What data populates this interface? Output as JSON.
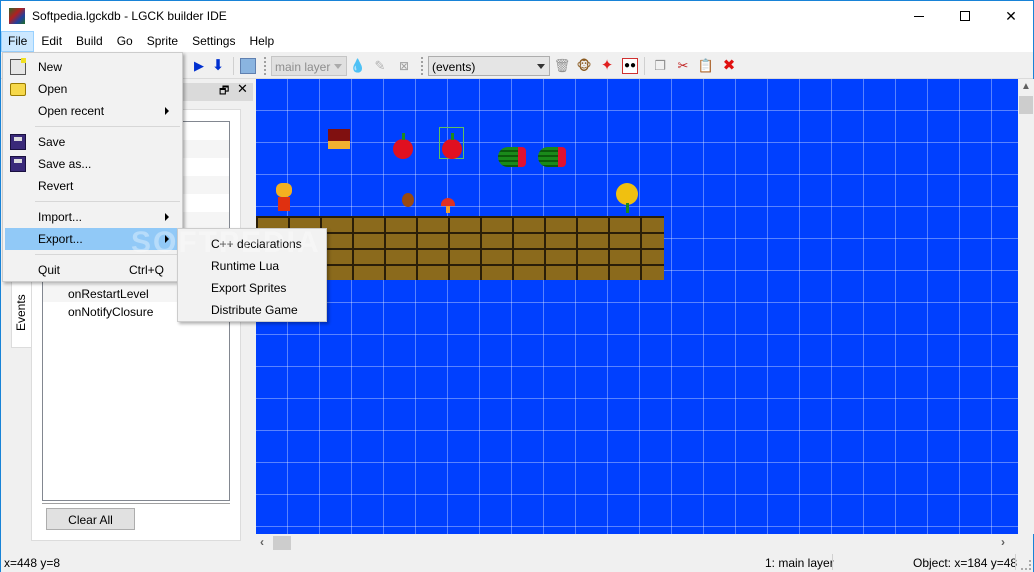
{
  "window": {
    "title": "Softpedia.lgckdb - LGCK builder IDE",
    "controls": [
      "minimize",
      "maximize",
      "close"
    ]
  },
  "menubar": {
    "items": [
      {
        "label": "File",
        "active": true
      },
      {
        "label": "Edit"
      },
      {
        "label": "Build"
      },
      {
        "label": "Go"
      },
      {
        "label": "Sprite"
      },
      {
        "label": "Settings"
      },
      {
        "label": "Help"
      }
    ]
  },
  "toolbar": {
    "layer_combo": {
      "value": "main layer",
      "enabled": false
    },
    "events_combo": {
      "value": "(events)"
    },
    "icons": [
      "play-icon",
      "arrow-down-icon",
      "sprite-editor-icon",
      "water-drop-icon",
      "pin-icon",
      "delete-box-icon",
      "trash-icon",
      "monkey-icon",
      "star-icon",
      "footprints-icon",
      "copy-icon",
      "cut-icon",
      "paste-icon",
      "delete-icon"
    ]
  },
  "file_menu": {
    "items": [
      {
        "label": "New",
        "icon": "new-file-icon"
      },
      {
        "label": "Open",
        "icon": "folder-open-icon"
      },
      {
        "label": "Open recent",
        "submenu": true
      },
      {
        "separator": true
      },
      {
        "label": "Save",
        "icon": "save-icon"
      },
      {
        "label": "Save as...",
        "icon": "save-as-icon"
      },
      {
        "label": "Revert"
      },
      {
        "separator": true
      },
      {
        "label": "Import...",
        "submenu": true
      },
      {
        "label": "Export...",
        "submenu": true,
        "highlighted": true
      },
      {
        "separator": true
      },
      {
        "label": "Quit",
        "shortcut": "Ctrl+Q"
      }
    ]
  },
  "export_submenu": {
    "items": [
      "C++ declarations",
      "Runtime Lua",
      "Export Sprites",
      "Distribute Game"
    ]
  },
  "events_panel": {
    "tab_label": "Events",
    "visible_items": [
      "onRestartLevel",
      "onNotifyClosure"
    ],
    "clear_button": "Clear All"
  },
  "canvas": {
    "background_color": "#0040ff",
    "grid_color": "#7f9fff",
    "objects": [
      "player",
      "book",
      "apple",
      "apple-selected",
      "watermelon",
      "watermelon",
      "coin",
      "mushroom",
      "flower",
      "brick-platform"
    ]
  },
  "statusbar": {
    "cursor": "x=448 y=8",
    "layer": "1: main layer",
    "object": "Object: x=184 y=48"
  },
  "watermark": "SOFTPEDIA"
}
